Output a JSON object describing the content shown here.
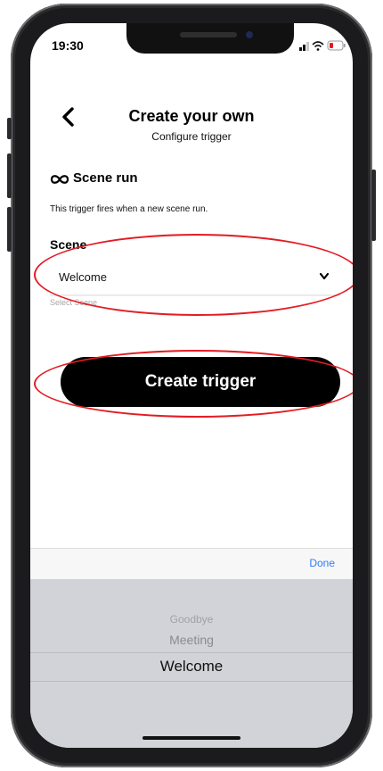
{
  "status_bar": {
    "time": "19:30"
  },
  "header": {
    "back_icon": "chevron-left-icon",
    "title": "Create your own",
    "subtitle": "Configure trigger"
  },
  "trigger": {
    "icon": "scene-loop-icon",
    "name": "Scene run",
    "description": "This trigger fires when a new scene run."
  },
  "scene_field": {
    "label": "Scene",
    "value": "Welcome",
    "helper": "Select Scene",
    "dropdown_icon": "chevron-down-icon"
  },
  "cta": {
    "label": "Create trigger"
  },
  "picker": {
    "done_label": "Done",
    "options": [
      "Goodbye",
      "Meeting",
      "Welcome"
    ],
    "selected": "Welcome"
  },
  "colors": {
    "highlight": "#e31c23",
    "done": "#2f7bf6",
    "button_bg": "#000000"
  }
}
